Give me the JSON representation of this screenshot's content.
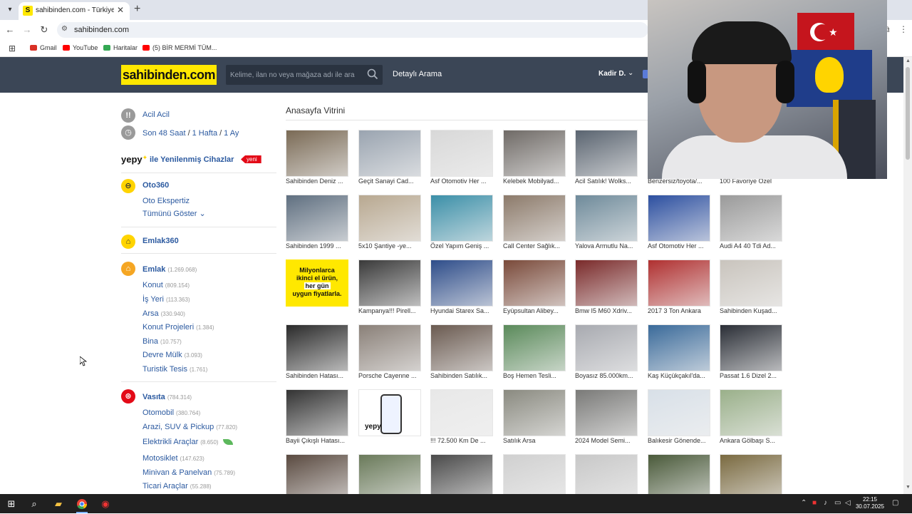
{
  "browser": {
    "tab_title": "sahibinden.com - Türkiye'nin Ö",
    "url": "sahibinden.com",
    "bookmarks": [
      {
        "label": "Gmail",
        "color": "#d93025"
      },
      {
        "label": "YouTube",
        "color": "#ff0000"
      },
      {
        "label": "Haritalar",
        "color": "#34a853"
      },
      {
        "label": "(5) BİR MERMİ TÜM...",
        "color": "#ff0000"
      }
    ]
  },
  "header": {
    "logo": "sahibinden.com",
    "search_placeholder": "Kelime, ilan no veya mağaza adı ile ara",
    "detailed_search": "Detaylı Arama",
    "user": "Kadir D."
  },
  "sidebar": {
    "urgent": "Acil Acil",
    "recent": {
      "a": "Son 48 Saat",
      "sep": "/",
      "b": "1 Hafta",
      "c": "1 Ay"
    },
    "yepy": {
      "logo": "yepy",
      "text": "ile Yenilenmiş Cihazlar",
      "badge": "yeni"
    },
    "oto360": {
      "title": "Oto360",
      "item": "Oto Ekspertiz",
      "show_all": "Tümünü Göster"
    },
    "emlak360": {
      "title": "Emlak360"
    },
    "emlak": {
      "title": "Emlak",
      "count": "(1.269.068)",
      "items": [
        {
          "label": "Konut",
          "count": "(809.154)"
        },
        {
          "label": "İş Yeri",
          "count": "(113.363)"
        },
        {
          "label": "Arsa",
          "count": "(330.940)"
        },
        {
          "label": "Konut Projeleri",
          "count": "(1.384)"
        },
        {
          "label": "Bina",
          "count": "(10.757)"
        },
        {
          "label": "Devre Mülk",
          "count": "(3.093)"
        },
        {
          "label": "Turistik Tesis",
          "count": "(1.761)"
        }
      ]
    },
    "vasita": {
      "title": "Vasıta",
      "count": "(784.314)",
      "items": [
        {
          "label": "Otomobil",
          "count": "(380.764)"
        },
        {
          "label": "Arazi, SUV & Pickup",
          "count": "(77.820)"
        },
        {
          "label": "Elektrikli Araçlar",
          "count": "(8.650)"
        },
        {
          "label": "Motosiklet",
          "count": "(147.623)"
        },
        {
          "label": "Minivan & Panelvan",
          "count": "(75.789)"
        },
        {
          "label": "Ticari Araçlar",
          "count": "(55.288)"
        }
      ]
    }
  },
  "showcase": {
    "title": "Anasayfa Vitrini",
    "promo": {
      "line1": "Milyonlarca",
      "line2": "ikinci el ürün,",
      "line3": "her gün",
      "line4": "uygun fiyatlarla."
    },
    "yepy_label": "yepy",
    "listings": [
      {
        "caption": "Sahibinden Deniz ...",
        "color": "#7a6a55"
      },
      {
        "caption": "Geçit Sanayi Cad...",
        "color": "#9aa4b0"
      },
      {
        "caption": "Asf Otomotiv Her ...",
        "color": "#d8d8d8"
      },
      {
        "caption": "Kelebek Mobilyad...",
        "color": "#6f6a66"
      },
      {
        "caption": "Acil Satılık! Wolks...",
        "color": "#5a6470"
      },
      {
        "caption": "Benzersiz/toyota/...",
        "color": "#8a8f95"
      },
      {
        "caption": "100 Favoriye Özel",
        "color": "#a0a5ab"
      },
      {
        "caption": "Sahibinden 1999 ...",
        "color": "#5f6f80"
      },
      {
        "caption": "5x10 Şantiye -ye...",
        "color": "#b8a890"
      },
      {
        "caption": "Özel Yapım Geniş ...",
        "color": "#3b8fa8"
      },
      {
        "caption": "Call Center Sağlık...",
        "color": "#8c7a6a"
      },
      {
        "caption": "Yalova Armutlu Na...",
        "color": "#6e8a9a"
      },
      {
        "caption": "Asf Otomotiv Her ...",
        "color": "#2c4fa0"
      },
      {
        "caption": "Audi A4 40 Tdi Ad...",
        "color": "#9a9a9a"
      },
      {
        "caption": "Kampanya!!! Pirell...",
        "color": "#3a3a3a"
      },
      {
        "caption": "Hyundai Starex Sa...",
        "color": "#2e4d8a"
      },
      {
        "caption": "Eyüpsultan Alibey...",
        "color": "#7a4a3a"
      },
      {
        "caption": "Bmw I5 M60 Xdriv...",
        "color": "#7a2a2a"
      },
      {
        "caption": "2017 3 Ton Ankara",
        "color": "#b03030"
      },
      {
        "caption": "Sahibinden Kuşad...",
        "color": "#c9c4bd"
      },
      {
        "caption": "Sahibinden Hatası...",
        "color": "#2a2a2a"
      },
      {
        "caption": "Porsche Cayenne ...",
        "color": "#8a8078"
      },
      {
        "caption": "Sahibinden Satılık...",
        "color": "#6a5a50"
      },
      {
        "caption": "Boş Hemen Tesli...",
        "color": "#5a8a5a"
      },
      {
        "caption": "Boyasız 85.000km...",
        "color": "#a8aab0"
      },
      {
        "caption": "Kaş Küçükçakıl'da...",
        "color": "#3a6a9a"
      },
      {
        "caption": "Passat 1.6 Dizel 2...",
        "color": "#2a2e36"
      },
      {
        "caption": "Bayii Çıkışlı Hatası...",
        "color": "#333333"
      },
      {
        "caption": "!!! 72.500 Km De ...",
        "color": "#e8e8e8"
      },
      {
        "caption": "Satılık Arsa",
        "color": "#8a8a80"
      },
      {
        "caption": "2024 Model Semi...",
        "color": "#7a7a78"
      },
      {
        "caption": "Balıkesir Gönende...",
        "color": "#d8e0e8"
      },
      {
        "caption": "Ankara Gölbaşı S...",
        "color": "#9ab08a"
      },
      {
        "caption": "",
        "color": "#5a4a40"
      },
      {
        "caption": "",
        "color": "#6a7a5a"
      },
      {
        "caption": "",
        "color": "#4a4a4a"
      },
      {
        "caption": "",
        "color": "#d0d0d0"
      },
      {
        "caption": "",
        "color": "#c8c8c8"
      },
      {
        "caption": "",
        "color": "#4a5a3a"
      },
      {
        "caption": "",
        "color": "#7a6a40"
      }
    ]
  },
  "taskbar": {
    "time": "22:15",
    "date": "30.07.2025"
  },
  "colors": {
    "brand_yellow": "#ffe800",
    "header_bg": "#3b4656",
    "link_blue": "#2c5aa0",
    "badge_red": "#e30a17"
  },
  "icons": [
    "search-icon",
    "back-icon",
    "forward-icon",
    "reload-icon",
    "windows-start-icon",
    "chrome-icon"
  ]
}
